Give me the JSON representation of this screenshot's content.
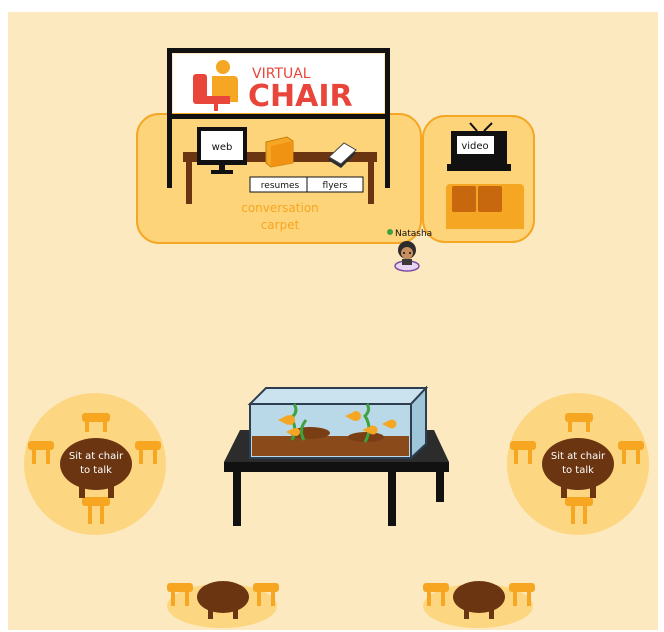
{
  "booth": {
    "sign_top": "VIRTUAL",
    "sign_main": "CHAIR",
    "web_label": "web",
    "resumes_label": "resumes",
    "flyers_label": "flyers",
    "carpet_line1": "conversation",
    "carpet_line2": "carpet",
    "video_label": "video"
  },
  "avatar": {
    "name": "Natasha",
    "status": "online"
  },
  "tables": {
    "left_label_1": "Sit at chair",
    "left_label_2": "to talk",
    "right_label_1": "Sit at chair",
    "right_label_2": "to talk"
  },
  "colors": {
    "background": "#fde9bf",
    "zone": "#fdd47a",
    "accent": "#f5a623",
    "brand_red": "#e8463a",
    "table_brown": "#6b3512",
    "chair_orange": "#f7a621"
  }
}
